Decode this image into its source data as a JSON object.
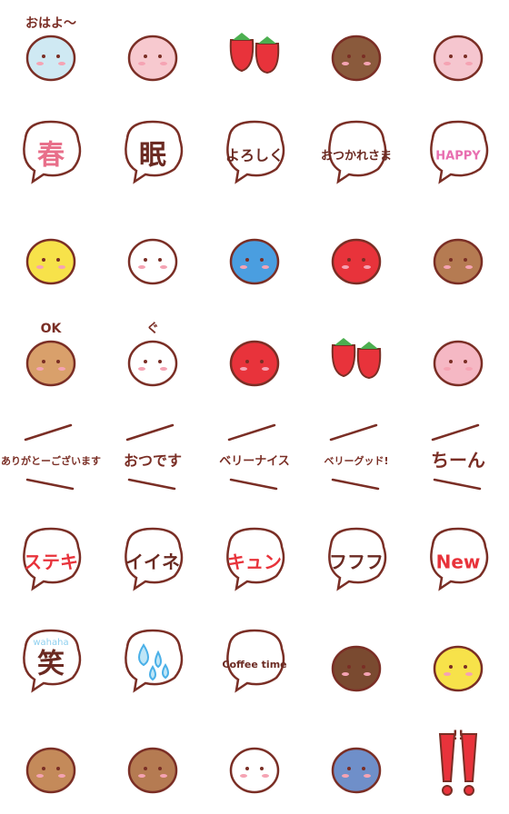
{
  "colors": {
    "outline": "#7a2e25",
    "red": "#e8333b",
    "pink": "#f5b8c4",
    "yellow": "#f7e24a",
    "blue": "#4a9ee0",
    "brown": "#b57b52",
    "cream": "#f6ead8"
  },
  "emoji": [
    {
      "kind": "figure",
      "label": "おはよ〜",
      "icon": "girl-icon",
      "fill": "#cfe9f3"
    },
    {
      "kind": "figure",
      "label": "",
      "icon": "teacup-icon",
      "fill": "#f7c9cf"
    },
    {
      "kind": "figure",
      "label": "",
      "icon": "strawberries-icon",
      "fill": "#e8333b"
    },
    {
      "kind": "figure",
      "label": "",
      "icon": "chocolate-parfait-icon",
      "fill": "#8a5a3c"
    },
    {
      "kind": "figure",
      "label": "",
      "icon": "roll-cake-icon",
      "fill": "#f5c6cf"
    },
    {
      "kind": "bubble",
      "label": "春",
      "icon": "spring-bubble-icon",
      "color": "#e86f8a"
    },
    {
      "kind": "bubble",
      "label": "眠",
      "icon": "sleepy-bubble-icon",
      "color": "#6b2a22"
    },
    {
      "kind": "bubble",
      "label": "よろしく",
      "icon": "yoroshiku-bubble-icon",
      "color": "#6b2a22"
    },
    {
      "kind": "bubble",
      "label": "おつかれさま",
      "icon": "otsukaresama-bubble-icon",
      "color": "#6b2a22"
    },
    {
      "kind": "bubble",
      "label": "HAPPY",
      "icon": "happy-bubble-icon",
      "color": "#e86fb0"
    },
    {
      "kind": "figure",
      "label": "",
      "icon": "yellow-bird-icon",
      "fill": "#f7e24a"
    },
    {
      "kind": "figure",
      "label": "",
      "icon": "white-bird-icon",
      "fill": "#ffffff"
    },
    {
      "kind": "figure",
      "label": "",
      "icon": "blue-bird-icon",
      "fill": "#4a9ee0"
    },
    {
      "kind": "figure",
      "label": "",
      "icon": "mushroom-turtle-icon",
      "fill": "#e8333b"
    },
    {
      "kind": "figure",
      "label": "",
      "icon": "hedgehog-icon",
      "fill": "#b57b52"
    },
    {
      "kind": "figure",
      "label": "OK",
      "icon": "chipmunk-ok-icon",
      "fill": "#d9a06b"
    },
    {
      "kind": "figure",
      "label": "ぐ",
      "icon": "thumbs-up-hand-icon",
      "fill": "#ffffff"
    },
    {
      "kind": "figure",
      "label": "",
      "icon": "strawberry-thumbs-up-icon",
      "fill": "#e8333b"
    },
    {
      "kind": "figure",
      "label": "",
      "icon": "falling-strawberries-icon",
      "fill": "#e8333b"
    },
    {
      "kind": "figure",
      "label": "",
      "icon": "pink-drink-cup-icon",
      "fill": "#f5b8c4"
    },
    {
      "kind": "banner",
      "label": "ありがとーございます",
      "icon": "arigato-banner-icon"
    },
    {
      "kind": "banner",
      "label": "おつです",
      "icon": "otsudesu-banner-icon"
    },
    {
      "kind": "banner",
      "label": "ベリーナイス",
      "icon": "very-nice-banner-icon"
    },
    {
      "kind": "banner",
      "label": "ベリーグッド!",
      "icon": "very-good-banner-icon"
    },
    {
      "kind": "banner",
      "label": "ちーん",
      "icon": "chiin-banner-icon"
    },
    {
      "kind": "bubble",
      "label": "ステキ",
      "icon": "suteki-bubble-icon",
      "color": "#e8333b"
    },
    {
      "kind": "bubble",
      "label": "イイネ",
      "icon": "iine-bubble-icon",
      "color": "#6b2a22"
    },
    {
      "kind": "bubble",
      "label": "キュン",
      "icon": "kyun-bubble-icon",
      "color": "#e8333b"
    },
    {
      "kind": "bubble",
      "label": "フフフ",
      "icon": "fufufu-bubble-icon",
      "color": "#6b2a22"
    },
    {
      "kind": "bubble",
      "label": "New",
      "icon": "new-bubble-icon",
      "color": "#e8333b"
    },
    {
      "kind": "bubble",
      "label": "笑",
      "sub": "wahaha",
      "icon": "laugh-bubble-icon",
      "color": "#6b2a22"
    },
    {
      "kind": "bubble",
      "label": "",
      "icon": "raindrops-bubble-icon",
      "color": "#4ab0e8"
    },
    {
      "kind": "bubble",
      "label": "Coffee time",
      "icon": "coffee-time-bubble-icon",
      "color": "#6b2a22"
    },
    {
      "kind": "figure",
      "label": "",
      "icon": "chocolate-cake-icon",
      "fill": "#7a4a30"
    },
    {
      "kind": "figure",
      "label": "",
      "icon": "lemon-drink-icon",
      "fill": "#f7e24a"
    },
    {
      "kind": "figure",
      "label": "",
      "icon": "bear-icon",
      "fill": "#c48a5a"
    },
    {
      "kind": "figure",
      "label": "",
      "icon": "sleeping-dog-icon",
      "fill": "#b57b52"
    },
    {
      "kind": "figure",
      "label": "",
      "icon": "cat-icon",
      "fill": "#ffffff"
    },
    {
      "kind": "figure",
      "label": "",
      "icon": "penguin-icon",
      "fill": "#6f8fc9"
    },
    {
      "kind": "figure",
      "label": "!!",
      "icon": "double-exclamation-icon",
      "fill": "#e8333b"
    }
  ]
}
